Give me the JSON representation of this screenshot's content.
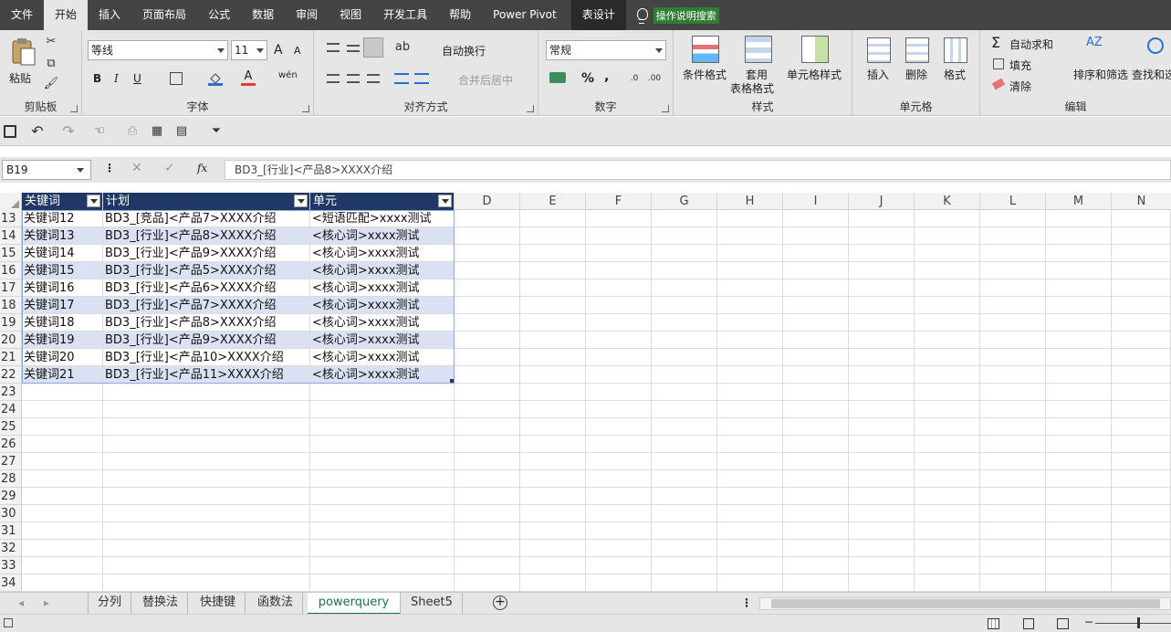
{
  "ribbon_tabs": [
    "文件",
    "开始",
    "插入",
    "页面布局",
    "公式",
    "数据",
    "审阅",
    "视图",
    "开发工具",
    "帮助",
    "Power Pivot",
    "表设计"
  ],
  "active_tab": "开始",
  "tell_me": "操作说明搜索",
  "clipboard": {
    "paste": "粘贴",
    "label": "剪贴板"
  },
  "font": {
    "name": "等线",
    "size": "11",
    "label": "字体",
    "grow": "A",
    "shrink": "A",
    "bold": "B",
    "italic": "I",
    "underline": "U",
    "phonetic": "wén"
  },
  "alignment": {
    "wrap": "自动换行",
    "merge": "合并后居中",
    "label": "对齐方式"
  },
  "number": {
    "format": "常规",
    "label": "数字",
    "percent": "%",
    "comma": ","
  },
  "styles": {
    "conditional": "条件格式",
    "table_line1": "套用",
    "table_line2": "表格格式",
    "cell_styles": "单元格样式",
    "label": "样式"
  },
  "cells_group": {
    "insert": "插入",
    "delete": "删除",
    "format": "格式",
    "label": "单元格"
  },
  "editing": {
    "autosum": "自动求和",
    "fill": "填充",
    "clear": "清除",
    "sort": "排序和筛选",
    "find": "查找和选",
    "label": "编辑"
  },
  "formula_bar": {
    "name_box": "B19",
    "fx": "fx",
    "content": "BD3_[行业]<产品8>XXXX介绍"
  },
  "columns": [
    "D",
    "E",
    "F",
    "G",
    "H",
    "I",
    "J",
    "K",
    "L",
    "M",
    "N"
  ],
  "table_headers": [
    "关键词",
    "计划",
    "单元"
  ],
  "rows": [
    {
      "n": "13",
      "a": "关键词12",
      "b": "BD3_[竞品]<产品7>XXXX介绍",
      "c": "<短语匹配>xxxx测试"
    },
    {
      "n": "14",
      "a": "关键词13",
      "b": "BD3_[行业]<产品8>XXXX介绍",
      "c": "<核心词>xxxx测试"
    },
    {
      "n": "15",
      "a": "关键词14",
      "b": "BD3_[行业]<产品9>XXXX介绍",
      "c": "<核心词>xxxx测试"
    },
    {
      "n": "16",
      "a": "关键词15",
      "b": "BD3_[行业]<产品5>XXXX介绍",
      "c": "<核心词>xxxx测试"
    },
    {
      "n": "17",
      "a": "关键词16",
      "b": "BD3_[行业]<产品6>XXXX介绍",
      "c": "<核心词>xxxx测试"
    },
    {
      "n": "18",
      "a": "关键词17",
      "b": "BD3_[行业]<产品7>XXXX介绍",
      "c": "<核心词>xxxx测试"
    },
    {
      "n": "19",
      "a": "关键词18",
      "b": "BD3_[行业]<产品8>XXXX介绍",
      "c": "<核心词>xxxx测试"
    },
    {
      "n": "20",
      "a": "关键词19",
      "b": "BD3_[行业]<产品9>XXXX介绍",
      "c": "<核心词>xxxx测试"
    },
    {
      "n": "21",
      "a": "关键词20",
      "b": "BD3_[行业]<产品10>XXXX介绍",
      "c": "<核心词>xxxx测试"
    },
    {
      "n": "22",
      "a": "关键词21",
      "b": "BD3_[行业]<产品11>XXXX介绍",
      "c": "<核心词>xxxx测试"
    }
  ],
  "empty_rows": [
    "23",
    "24",
    "25",
    "26",
    "27",
    "28",
    "29",
    "30",
    "31",
    "32",
    "33",
    "34"
  ],
  "sheets": [
    "分列",
    "替换法",
    "快捷键",
    "函数法",
    "powerquery",
    "Sheet5"
  ],
  "active_sheet": "powerquery",
  "colors": {
    "accent": "#1e7145",
    "table_header": "#1f3864",
    "band": "#d9e1f2",
    "tab_bg": "#444444"
  }
}
